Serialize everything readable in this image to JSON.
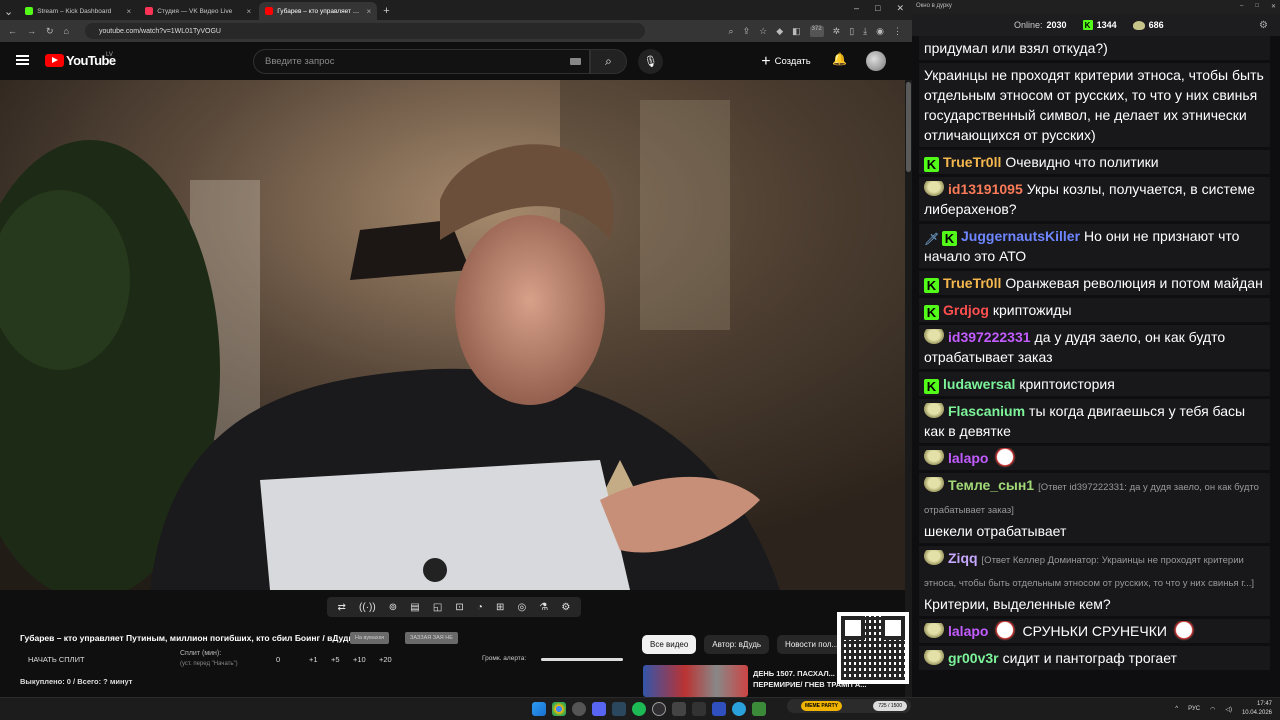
{
  "browser": {
    "tabs": [
      {
        "label": "Stream – Kick Dashboard",
        "color": "#53fc18",
        "active": false
      },
      {
        "label": "Студия — VK Видео Live",
        "color": "#ff3355",
        "active": false
      },
      {
        "label": "Губарев – кто управляет Пути...",
        "color": "#ff0000",
        "active": true
      }
    ],
    "url": "youtube.com/watch?v=1WL01TyVOGU",
    "ext_badge": "372"
  },
  "youtube": {
    "logo_text": "YouTube",
    "region": "LV",
    "search_placeholder": "Введите запрос",
    "create_label": "Создать",
    "video_title": "Губарев – кто управляет Путиным, миллион погибших, кто сбил Боинг / вДудь",
    "chips": [
      "Все видео",
      "Автор: вДудь",
      "Новости пол..."
    ],
    "related_title": "ДЕНЬ 1507. ПАСХАЛ... ПЕРЕМИРИЕ/ ГНЕВ ТРАМП А...",
    "controls": [
      "⇄",
      "((·))",
      "⊚",
      "▤",
      "◱",
      "⊡",
      "◔",
      "⊞",
      "◎",
      "⚗",
      "⚙"
    ]
  },
  "overlay": {
    "small_chips": [
      "На вумахач",
      "ЗАЗЗАЯ ЗАЯ НЕ"
    ],
    "start_split": "НАЧАТЬ СПЛИТ",
    "split_label": "Сплит (мин):",
    "split_sub": "(уст. перед \"Начать\")",
    "split_value": "0",
    "split_steps": [
      "+1",
      "+5",
      "+10",
      "+20"
    ],
    "volume_label": "Громк. алерта:",
    "volume_level": 1.0,
    "bought": "Выкуплено: 0 / Всего: ? минут"
  },
  "chat_window": {
    "title": "Окно в дурку",
    "online_label": "Online:",
    "online_count": "2030",
    "kick_count": "1344",
    "other_count": "686"
  },
  "chat": [
    {
      "name": "",
      "color": "#ffffff",
      "badges": [],
      "reply": "",
      "text": "придумал или взял откуда?)"
    },
    {
      "name": "",
      "color": "#ffffff",
      "badges": [],
      "reply": "",
      "text": "Украинцы не проходят критерии этноса, чтобы быть отдельным этносом от русских, то что у них свинья государственный символ, не делает их этнически отличающихся от русских)"
    },
    {
      "name": "TrueTr0ll",
      "color": "#f5b74e",
      "badges": [
        "kick"
      ],
      "reply": "",
      "text": "Очевидно что политики"
    },
    {
      "name": "id13191095",
      "color": "#f97b57",
      "badges": [
        "pepe"
      ],
      "reply": "",
      "text": "Укры козлы, получается, в системе либерахенов?"
    },
    {
      "name": "JuggernautsKiller",
      "color": "#6e86ff",
      "badges": [
        "sword",
        "kick"
      ],
      "reply": "",
      "text": "Но они не признают что начало это АТО"
    },
    {
      "name": "TrueTr0ll",
      "color": "#f5b74e",
      "badges": [
        "kick"
      ],
      "reply": "",
      "text": "Оранжевая революция и потом майдан"
    },
    {
      "name": "Grdjog",
      "color": "#ff4f4f",
      "badges": [
        "kick"
      ],
      "reply": "",
      "text": "криптожиды"
    },
    {
      "name": "id397222331",
      "color": "#c25cff",
      "badges": [
        "pepe"
      ],
      "reply": "",
      "text": "да у дудя заело, он как будто отрабатывает заказ"
    },
    {
      "name": "ludawersal",
      "color": "#7df39a",
      "badges": [
        "kick"
      ],
      "reply": "",
      "text": "криптоистория"
    },
    {
      "name": "Flascanium",
      "color": "#7df39a",
      "badges": [
        "pepe"
      ],
      "reply": "",
      "text": "ты когда двигаешься у тебя басы как в девятке"
    },
    {
      "name": "lalapo",
      "color": "#c25cff",
      "badges": [
        "pepe"
      ],
      "reply": "",
      "text": "",
      "emote": true
    },
    {
      "name": "Темле_сын1",
      "color": "#a3d977",
      "badges": [
        "pepe"
      ],
      "reply": "[Ответ id397222331: да у дудя заело, он как будто отрабатывает заказ]",
      "text": "шекели отрабатывает"
    },
    {
      "name": "Ziqq",
      "color": "#c7a8ff",
      "badges": [
        "pepe"
      ],
      "reply": "[Ответ Келлер Доминатор: Украинцы не проходят критерии этноса, чтобы быть отдельным этносом от русских, то что у них свинья г...]",
      "text": "Критерии, выделенные кем?"
    },
    {
      "name": "lalapo",
      "color": "#c25cff",
      "badges": [
        "pepe"
      ],
      "reply": "",
      "text": "СРУНЬКИ СРУНЕЧКИ",
      "emote": true,
      "emote_after": true
    },
    {
      "name": "gr00v3r",
      "color": "#7df39a",
      "badges": [
        "pepe"
      ],
      "reply": "",
      "text": "сидит и пантограф трогает"
    }
  ],
  "taskbar": {
    "lang": "РУС",
    "time": "17:47",
    "date": "10.04.2026",
    "meme_label": "MEME PARTY",
    "meme_count": "725 / 1500"
  }
}
